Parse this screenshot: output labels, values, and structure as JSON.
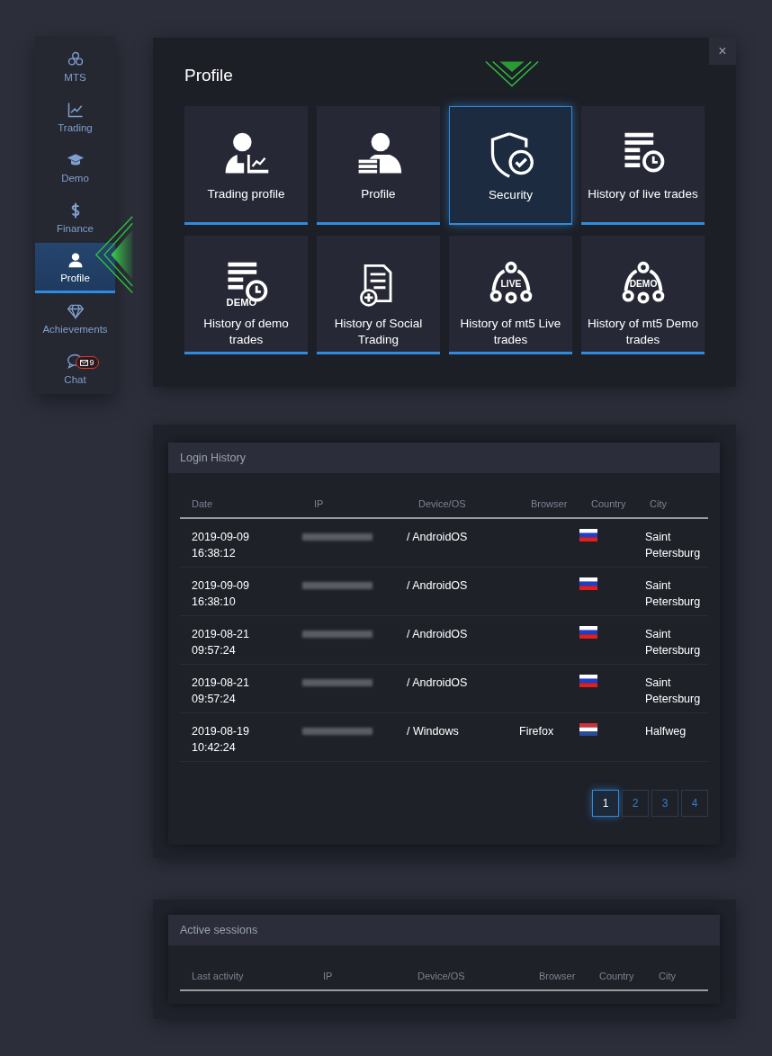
{
  "sidebar": {
    "items": [
      {
        "label": "MTS",
        "kind": "network",
        "selected": false
      },
      {
        "label": "Trading",
        "kind": "chart",
        "selected": false
      },
      {
        "label": "Demo",
        "kind": "cap",
        "selected": false
      },
      {
        "label": "Finance",
        "kind": "dollar",
        "selected": false
      },
      {
        "label": "Profile",
        "kind": "person",
        "selected": true
      },
      {
        "label": "Achievements",
        "kind": "diamond",
        "selected": false
      },
      {
        "label": "Chat",
        "kind": "chat",
        "selected": false,
        "badge": "9"
      }
    ]
  },
  "profile_menu": {
    "title": "Profile",
    "close": "×",
    "tiles": [
      {
        "label": "Trading profile",
        "kind": "person-chart",
        "selected": false
      },
      {
        "label": "Profile",
        "kind": "person-list",
        "selected": false
      },
      {
        "label": "Security",
        "kind": "shield",
        "selected": true
      },
      {
        "label": "History of live trades",
        "kind": "list-clock",
        "selected": false
      },
      {
        "label": "History of demo trades",
        "kind": "list-clock",
        "icon_text": "DEMO",
        "selected": false
      },
      {
        "label": "History of Social Trading",
        "kind": "document",
        "selected": false
      },
      {
        "label": "History of mt5 Live trades",
        "kind": "network",
        "icon_text": "LIVE",
        "selected": false
      },
      {
        "label": "History of mt5 Demo trades",
        "kind": "network",
        "icon_text": "DEMO",
        "selected": false
      }
    ]
  },
  "login_history": {
    "title": "Login History",
    "columns": [
      "Date",
      "IP",
      "Device/OS",
      "Browser",
      "Country",
      "City"
    ],
    "rows": [
      {
        "date": "2019-09-09 16:38:12",
        "device": "/ AndroidOS",
        "kind": "russia",
        "city": "Saint Petersburg"
      },
      {
        "date": "2019-09-09 16:38:10",
        "device": "/ AndroidOS",
        "kind": "russia",
        "city": "Saint Petersburg"
      },
      {
        "date": "2019-08-21 09:57:24",
        "device": "/ AndroidOS",
        "kind": "russia",
        "city": "Saint Petersburg"
      },
      {
        "date": "2019-08-21 09:57:24",
        "device": "/ AndroidOS",
        "kind": "russia",
        "city": "Saint Petersburg"
      },
      {
        "date": "2019-08-19 10:42:24",
        "device": "/ Windows",
        "browser": "Firefox",
        "kind": "netherlands",
        "city": "Halfweg"
      }
    ],
    "pages": [
      {
        "label": "1",
        "selected": true
      },
      {
        "label": "2",
        "selected": false
      },
      {
        "label": "3",
        "selected": false
      },
      {
        "label": "4",
        "selected": false
      }
    ]
  },
  "active_sessions": {
    "title": "Active sessions",
    "columns": [
      "Last activity",
      "IP",
      "Device/OS",
      "Browser",
      "Country",
      "City"
    ]
  }
}
